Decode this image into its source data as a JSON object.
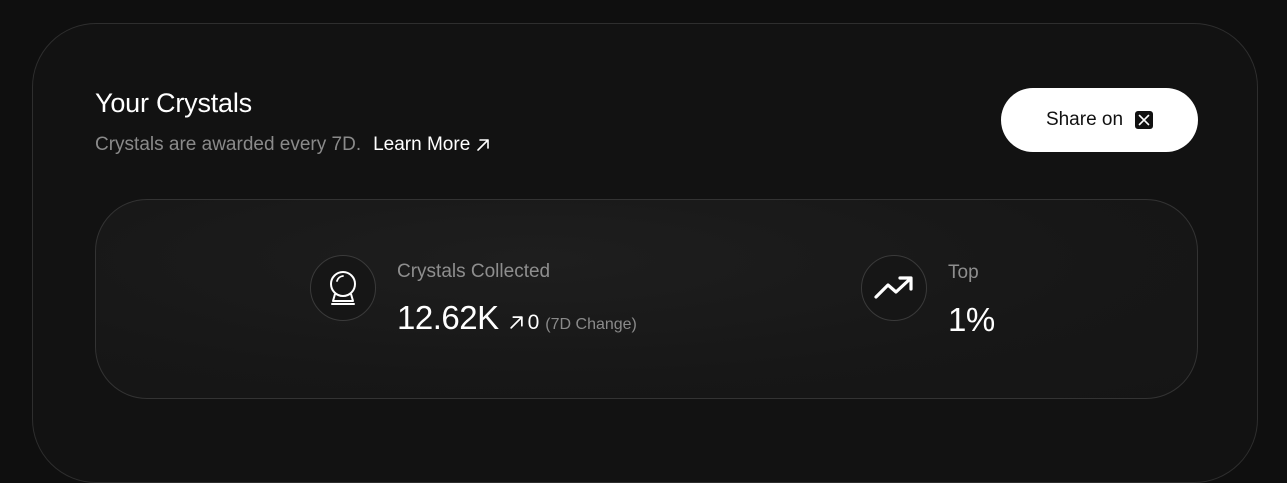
{
  "header": {
    "title": "Your Crystals",
    "subtitle": "Crystals are awarded every 7D.",
    "learn_more_label": "Learn More",
    "learn_more_icon": "arrow-up-right-icon"
  },
  "share": {
    "label": "Share on",
    "icon": "x-logo-icon"
  },
  "stats": {
    "crystals": {
      "icon": "crystal-ball-icon",
      "label": "Crystals Collected",
      "value": "12.62K",
      "change_icon": "arrow-up-right-icon",
      "change_value": "0",
      "change_note": "(7D Change)"
    },
    "rank": {
      "icon": "trending-up-icon",
      "label": "Top",
      "value": "1%"
    }
  },
  "colors": {
    "background": "#0f0f0f",
    "panel": "#121212",
    "muted_text": "#8a8a8a",
    "button_bg": "#ffffff"
  }
}
